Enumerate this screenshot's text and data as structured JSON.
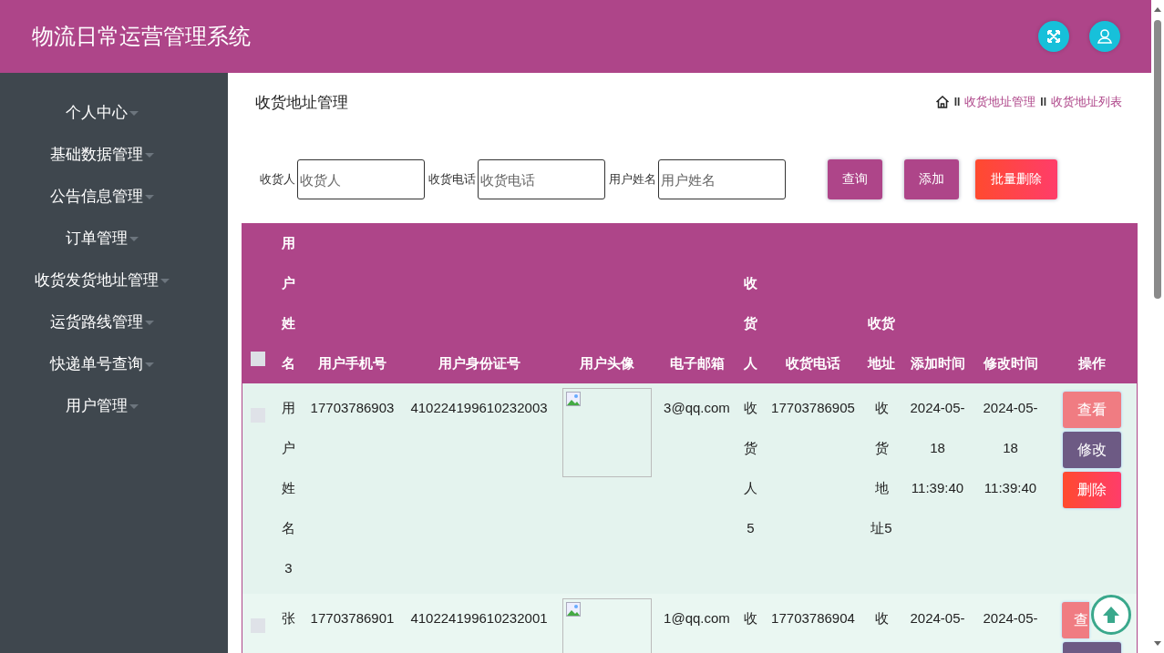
{
  "header": {
    "title": "物流日常运营管理系统"
  },
  "sidebar": {
    "items": [
      {
        "label": "个人中心"
      },
      {
        "label": "基础数据管理"
      },
      {
        "label": "公告信息管理"
      },
      {
        "label": "订单管理"
      },
      {
        "label": "收货发货地址管理"
      },
      {
        "label": "运货路线管理"
      },
      {
        "label": "快递单号查询"
      },
      {
        "label": "用户管理"
      }
    ]
  },
  "page": {
    "title": "收货地址管理",
    "breadcrumb": [
      {
        "kind": "home"
      },
      {
        "kind": "separator",
        "text": "II"
      },
      {
        "kind": "link",
        "text": "收货地址管理"
      },
      {
        "kind": "separator",
        "text": "II"
      },
      {
        "kind": "link",
        "text": "收货地址列表"
      }
    ]
  },
  "search": {
    "fields": [
      {
        "label": "收货人",
        "placeholder": "收货人"
      },
      {
        "label": "收货电话",
        "placeholder": "收货电话"
      },
      {
        "label": "用户姓名",
        "placeholder": "用户姓名"
      }
    ],
    "buttons": [
      {
        "label": "查询",
        "kind": "primary"
      },
      {
        "label": "添加",
        "kind": "primary"
      },
      {
        "label": "批量删除",
        "kind": "danger"
      }
    ]
  },
  "table": {
    "columns": [
      {
        "kind": "checkbox",
        "checked": false
      },
      {
        "kind": "text",
        "label": "用户姓名"
      },
      {
        "kind": "text",
        "label": "用户手机号"
      },
      {
        "kind": "text",
        "label": "用户身份证号"
      },
      {
        "kind": "text",
        "label": "用户头像"
      },
      {
        "kind": "text",
        "label": "电子邮箱"
      },
      {
        "kind": "text",
        "label": "收货人"
      },
      {
        "kind": "text",
        "label": "收货电话"
      },
      {
        "kind": "text",
        "label": "收货地址"
      },
      {
        "kind": "text",
        "label": "添加时间"
      },
      {
        "kind": "text",
        "label": "修改时间"
      },
      {
        "kind": "text",
        "label": "操作"
      }
    ],
    "rows": [
      {
        "cells": [
          {
            "kind": "checkbox",
            "checked": false
          },
          {
            "kind": "text",
            "text": "用户姓名3"
          },
          {
            "kind": "text",
            "text": "17703786903"
          },
          {
            "kind": "text",
            "text": "410224199610232003"
          },
          {
            "kind": "image"
          },
          {
            "kind": "text",
            "text": "3@qq.com"
          },
          {
            "kind": "text",
            "text": "收货人5"
          },
          {
            "kind": "text",
            "text": "17703786905"
          },
          {
            "kind": "text",
            "text": "收货地址5"
          },
          {
            "kind": "text",
            "text": "2024-05-18 11:39:40"
          },
          {
            "kind": "text",
            "text": "2024-05-18 11:39:40"
          },
          {
            "kind": "actions",
            "actions": [
              {
                "kind": "view",
                "label": "查看"
              },
              {
                "kind": "edit",
                "label": "修改"
              },
              {
                "kind": "delete",
                "label": "删除"
              }
            ]
          }
        ]
      },
      {
        "cells": [
          {
            "kind": "checkbox",
            "checked": false
          },
          {
            "kind": "text",
            "text": "张"
          },
          {
            "kind": "text",
            "text": "17703786901"
          },
          {
            "kind": "text",
            "text": "410224199610232001"
          },
          {
            "kind": "image"
          },
          {
            "kind": "text",
            "text": "1@qq.com"
          },
          {
            "kind": "text",
            "text": "收"
          },
          {
            "kind": "text",
            "text": "17703786904"
          },
          {
            "kind": "text",
            "text": "收"
          },
          {
            "kind": "text",
            "text": "2024-05-"
          },
          {
            "kind": "text",
            "text": "2024-05-"
          },
          {
            "kind": "actions",
            "actions": [
              {
                "kind": "view",
                "label": "查"
              },
              {
                "kind": "edit"
              }
            ]
          }
        ]
      }
    ]
  }
}
